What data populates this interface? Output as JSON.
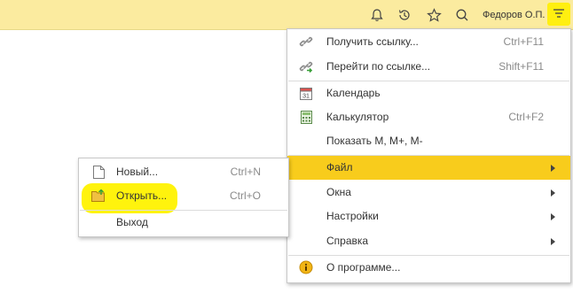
{
  "topbar": {
    "bell_icon": "bell-icon",
    "history_icon": "history-icon",
    "favorites_icon": "star-icon",
    "search_icon": "search-icon",
    "user_name": "Федоров О.П.",
    "menu_icon": "hamburger-menu-icon",
    "background": "#fbeb9f",
    "highlight": "#ffef10"
  },
  "main_menu": {
    "items": [
      {
        "label": "Получить ссылку...",
        "shortcut": "Ctrl+F11",
        "icon": "link-icon"
      },
      {
        "label": "Перейти по ссылке...",
        "shortcut": "Shift+F11",
        "icon": "goto-link-icon"
      },
      {
        "label": "Календарь",
        "icon": "calendar-icon",
        "icon_text": "31"
      },
      {
        "label": "Калькулятор",
        "shortcut": "Ctrl+F2",
        "icon": "calculator-icon"
      },
      {
        "label": "Показать M, M+, M-"
      },
      {
        "label": "Файл",
        "submenu": true,
        "active": true
      },
      {
        "label": "Окна",
        "submenu": true
      },
      {
        "label": "Настройки",
        "submenu": true
      },
      {
        "label": "Справка",
        "submenu": true
      },
      {
        "label": "О программе...",
        "icon": "info-icon"
      }
    ],
    "active_color": "#f8cc1c"
  },
  "file_submenu": {
    "items": [
      {
        "label": "Новый...",
        "shortcut": "Ctrl+N",
        "icon": "new-document-icon"
      },
      {
        "label": "Открыть...",
        "shortcut": "Ctrl+O",
        "icon": "open-folder-icon",
        "highlighted": true
      },
      {
        "label": "Выход"
      }
    ]
  }
}
